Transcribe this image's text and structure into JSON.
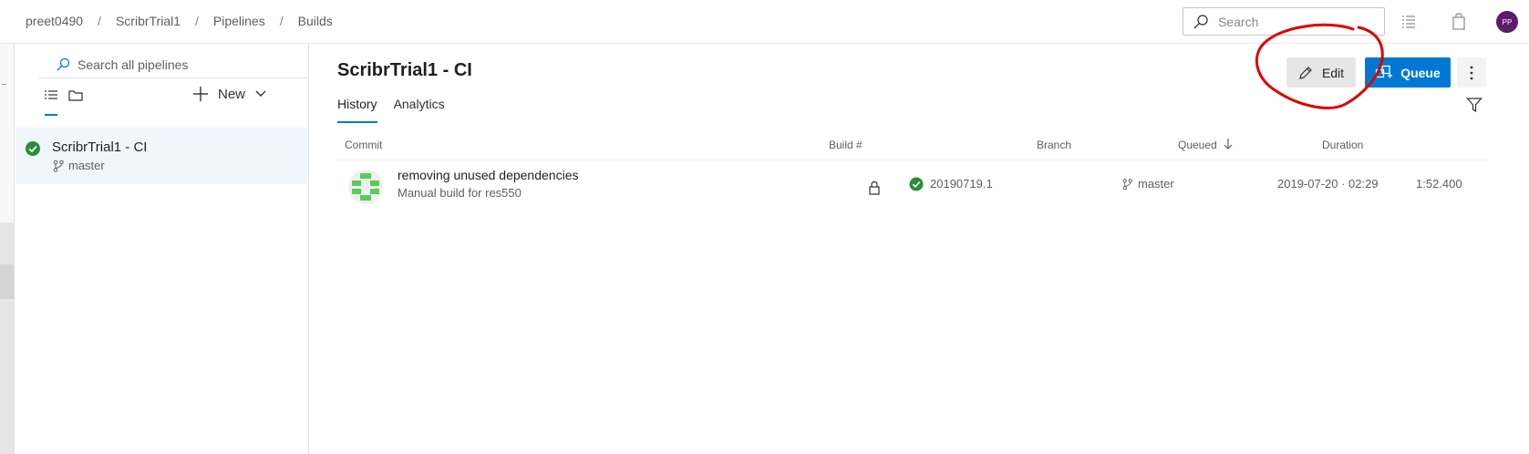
{
  "breadcrumbs": [
    "preet0490",
    "ScribrTrial1",
    "Pipelines",
    "Builds"
  ],
  "header": {
    "search_placeholder": "Search",
    "avatar_initials": "PP"
  },
  "sidebar": {
    "search_placeholder": "Search all pipelines",
    "new_label": "New",
    "pipelines": [
      {
        "name": "ScribrTrial1 - CI",
        "branch": "master",
        "status": "succeeded"
      }
    ]
  },
  "main": {
    "title": "ScribrTrial1 - CI",
    "edit_label": "Edit",
    "queue_label": "Queue",
    "tabs": [
      {
        "label": "History",
        "active": true
      },
      {
        "label": "Analytics",
        "active": false
      }
    ],
    "columns": {
      "commit": "Commit",
      "build": "Build #",
      "branch": "Branch",
      "queued": "Queued",
      "duration": "Duration"
    },
    "rows": [
      {
        "commit_title": "removing unused dependencies",
        "commit_subtitle": "Manual build for res550",
        "build_number": "20190719.1",
        "branch": "master",
        "queued": "2019-07-20 · 02:29",
        "duration": "1:52.400",
        "status": "succeeded"
      }
    ]
  },
  "colors": {
    "accent": "#0078d4",
    "success": "#107c10",
    "annotation": "#e00000",
    "avatar": "#5c1b6c"
  }
}
